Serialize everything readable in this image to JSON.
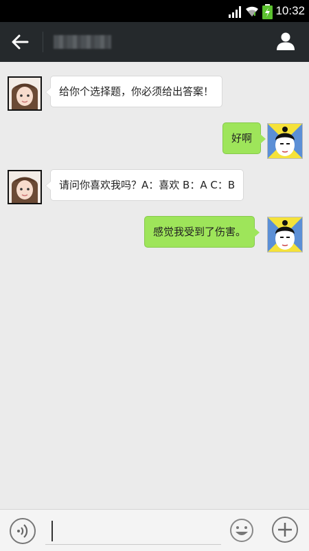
{
  "status_bar": {
    "time": "10:32",
    "icons": [
      "signal-icon",
      "wifi-icon",
      "battery-charging-icon"
    ]
  },
  "header": {
    "back_icon": "back-arrow-icon",
    "contact_name_blurred": true,
    "profile_icon": "user-profile-icon"
  },
  "messages": [
    {
      "from": "other",
      "text": "给你个选择题，你必须给出答案！"
    },
    {
      "from": "self",
      "text": "好啊"
    },
    {
      "from": "other",
      "text": "请问你喜欢我吗？A：喜欢  B：A  C：B"
    },
    {
      "from": "self",
      "text": "感觉我受到了伤害。"
    }
  ],
  "input_bar": {
    "voice_icon": "voice-icon",
    "text_value": "",
    "emoji_icon": "emoji-icon",
    "plus_icon": "plus-icon"
  },
  "colors": {
    "header_bg": "#25292c",
    "chat_bg": "#ebebeb",
    "self_bubble": "#9ee55a",
    "other_bubble": "#ffffff"
  }
}
